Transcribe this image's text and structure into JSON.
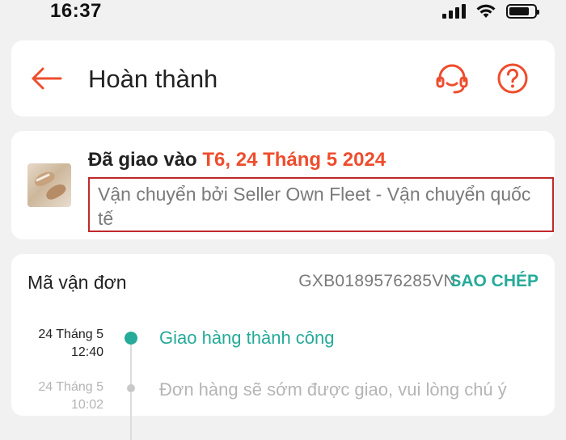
{
  "status_bar": {
    "time": "16:37",
    "signal_icon": "signal-icon",
    "wifi_icon": "wifi-icon",
    "battery_icon": "battery-icon"
  },
  "header": {
    "title": "Hoàn thành",
    "back_icon": "arrow-left-icon",
    "support_icon": "headset-icon",
    "help_icon": "question-circle-icon"
  },
  "delivery": {
    "prefix": "Đã giao vào ",
    "date": "T6, 24 Tháng 5 2024",
    "carrier": "Vận chuyển bởi Seller Own Fleet - Vận chuyển quốc tế"
  },
  "tracking": {
    "label": "Mã vận đơn",
    "code": "GXB0189576285VN",
    "copy_label": "SAO CHÉP",
    "events": [
      {
        "date": "24 Tháng 5",
        "time": "12:40",
        "text": "Giao hàng thành công",
        "status": "done"
      },
      {
        "date": "24 Tháng 5",
        "time": "10:02",
        "text": "Đơn hàng sẽ sớm được giao, vui lòng chú ý",
        "status": "past"
      }
    ]
  },
  "colors": {
    "accent": "#ee4d2d",
    "success": "#26aa99",
    "highlight_border": "#c0282b",
    "muted_text": "#7a7a7a"
  }
}
